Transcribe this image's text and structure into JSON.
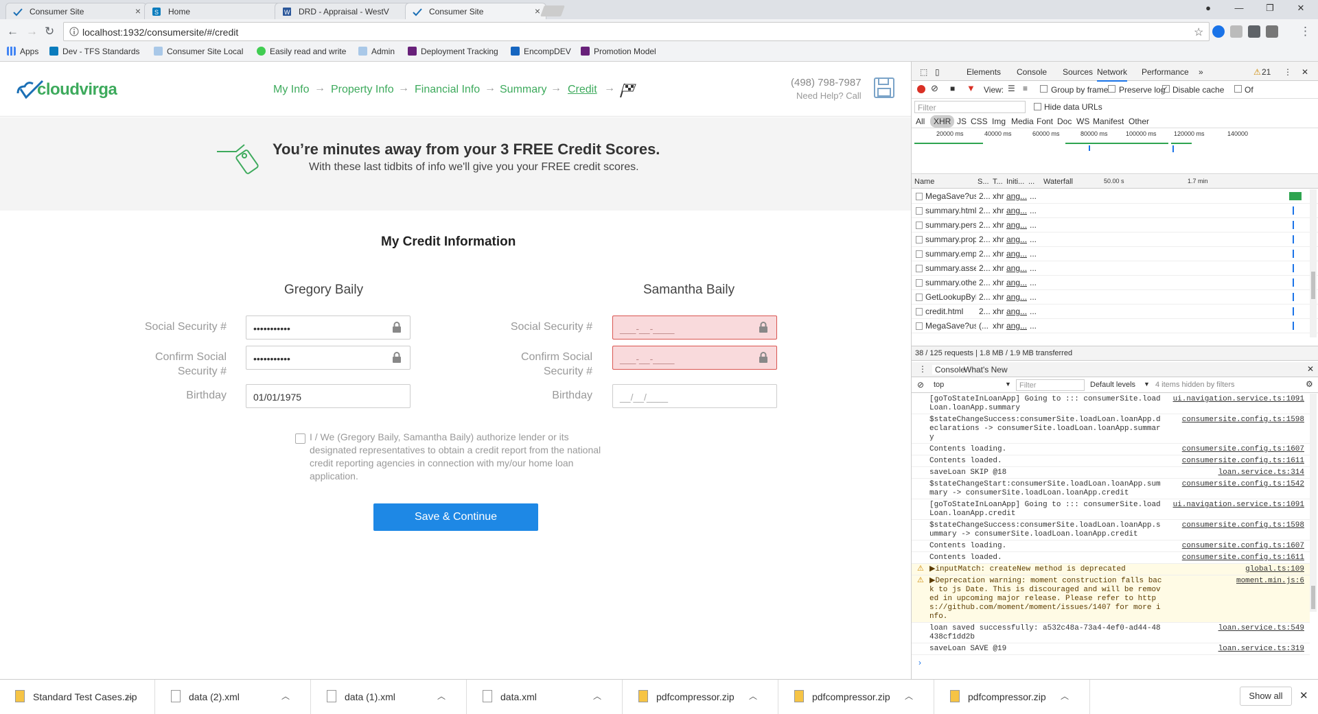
{
  "tabs": [
    {
      "title": "Consumer Site",
      "icon": "cloudvirga-icon"
    },
    {
      "title": "Home",
      "icon": "sharepoint-icon"
    },
    {
      "title": "DRD - Appraisal - WestV",
      "icon": "word-icon"
    },
    {
      "title": "Consumer Site",
      "icon": "cloudvirga-icon",
      "active": true
    }
  ],
  "url": "localhost:1932/consumersite/#/credit",
  "bookmarks": [
    "Apps",
    "Dev - TFS Standards",
    "Consumer Site Local",
    "Easily read and write",
    "Admin",
    "Deployment Tracking",
    "EncompDEV",
    "Promotion Model"
  ],
  "site": {
    "logo": "cloudvirga",
    "steps": [
      "My Info",
      "Property Info",
      "Financial Info",
      "Summary",
      "Credit"
    ],
    "active_step": "Credit",
    "phone": "(498) 798-7987",
    "help": "Need Help? Call",
    "hero_title": "You’re minutes away from your 3 FREE Credit Scores.",
    "hero_sub": "With these last tidbits of info we'll give you your FREE credit scores.",
    "section_title": "My Credit Information",
    "borrowers": [
      {
        "name": "Gregory Baily",
        "ssn_label": "Social Security #",
        "confirm_label_1": "Confirm Social",
        "confirm_label_2": "Security #",
        "birthday_label": "Birthday",
        "ssn": "•••••••••••",
        "confirm": "•••••••••••",
        "birthday": "01/01/1975"
      },
      {
        "name": "Samantha Baily",
        "ssn_label": "Social Security #",
        "confirm_label_1": "Confirm Social",
        "confirm_label_2": "Security #",
        "birthday_label": "Birthday",
        "ssn": "___-__-____",
        "confirm": "___-__-____",
        "birthday": "__/__/____"
      }
    ],
    "authorize_1": "I / We (Gregory Baily, Samantha Baily) authorize lender or its",
    "authorize_2": "designated representatives to obtain a credit report from the national",
    "authorize_3": "credit reporting agencies in connection with my/our home loan",
    "authorize_4": "application.",
    "save_button": "Save & Continue"
  },
  "devtools": {
    "tabs": [
      "Elements",
      "Console",
      "Sources",
      "Network",
      "Performance"
    ],
    "active_tab": "Network",
    "warn_count": "21",
    "view_label": "View:",
    "group_by_frame": "Group by frame",
    "preserve_log": "Preserve log",
    "disable_cache": "Disable cache",
    "offline": "Of",
    "filter_placeholder": "Filter",
    "hide_data_urls": "Hide data URLs",
    "types": [
      "All",
      "XHR",
      "JS",
      "CSS",
      "Img",
      "Media",
      "Font",
      "Doc",
      "WS",
      "Manifest",
      "Other"
    ],
    "timeline_ticks": [
      "20000 ms",
      "40000 ms",
      "60000 ms",
      "80000 ms",
      "100000 ms",
      "120000 ms",
      "140000"
    ],
    "columns": {
      "name": "Name",
      "status": "S...",
      "type": "T...",
      "initiator": "Initi...",
      "more": "...",
      "waterfall": "Waterfall",
      "w1": "50.00 s",
      "w2": "1.7 min"
    },
    "requests": [
      {
        "name": "MegaSave?us...",
        "status": "2...",
        "type": "xhr",
        "init": "ang..."
      },
      {
        "name": "summary.html",
        "status": "2...",
        "type": "xhr",
        "init": "ang..."
      },
      {
        "name": "summary.pers...",
        "status": "2...",
        "type": "xhr",
        "init": "ang..."
      },
      {
        "name": "summary.prop...",
        "status": "2...",
        "type": "xhr",
        "init": "ang..."
      },
      {
        "name": "summary.emp...",
        "status": "2...",
        "type": "xhr",
        "init": "ang..."
      },
      {
        "name": "summary.asse...",
        "status": "2...",
        "type": "xhr",
        "init": "ang..."
      },
      {
        "name": "summary.othe...",
        "status": "2...",
        "type": "xhr",
        "init": "ang..."
      },
      {
        "name": "GetLookupByL...",
        "status": "2...",
        "type": "xhr",
        "init": "ang..."
      },
      {
        "name": "credit.html",
        "status": "2...",
        "type": "xhr",
        "init": "ang..."
      },
      {
        "name": "MegaSave?us...",
        "status": "(...",
        "type": "xhr",
        "init": "ang..."
      }
    ],
    "summary": "38 / 125 requests  |  1.8 MB / 1.9 MB transferred",
    "drawer_tabs": [
      "Console",
      "What's New"
    ],
    "context": "top",
    "console_filter": "Filter",
    "levels": "Default levels",
    "hidden": "4 items hidden by filters",
    "logs": [
      {
        "msg": "[goToStateInLoanApp] Going to ::: consumerSite.loadLoan.loanApp.summary",
        "src": "ui.navigation.service.ts:1091"
      },
      {
        "msg": "$stateChangeSuccess:consumerSite.loadLoan.loanApp.declarations -> consumerSite.loadLoan.loanApp.summary",
        "src": "consumersite.config.ts:1598"
      },
      {
        "msg": "Contents loading.",
        "src": "consumersite.config.ts:1607"
      },
      {
        "msg": "Contents loaded.",
        "src": "consumersite.config.ts:1611"
      },
      {
        "msg": "saveLoan SKIP @18",
        "src": "loan.service.ts:314"
      },
      {
        "msg": "$stateChangeStart:consumerSite.loadLoan.loanApp.summary -> consumerSite.loadLoan.loanApp.credit",
        "src": "consumersite.config.ts:1542"
      },
      {
        "msg": "[goToStateInLoanApp] Going to ::: consumerSite.loadLoan.loanApp.credit",
        "src": "ui.navigation.service.ts:1091"
      },
      {
        "msg": "$stateChangeSuccess:consumerSite.loadLoan.loanApp.summary -> consumerSite.loadLoan.loanApp.credit",
        "src": "consumersite.config.ts:1598"
      },
      {
        "msg": "Contents loading.",
        "src": "consumersite.config.ts:1607"
      },
      {
        "msg": "Contents loaded.",
        "src": "consumersite.config.ts:1611"
      },
      {
        "msg": "▶inputMatch: createNew method is deprecated",
        "src": "global.ts:109",
        "warn": true
      },
      {
        "msg": "▶Deprecation warning: moment construction falls back to js Date. This is discouraged and will be removed in upcoming major release. Please refer to https://github.com/moment/moment/issues/1407 for more info.",
        "src": "moment.min.js:6",
        "warn": true
      },
      {
        "msg": "loan saved successfully: a532c48a-73a4-4ef0-ad44-48438cf1dd2b",
        "src": "loan.service.ts:549"
      },
      {
        "msg": "saveLoan SAVE @19",
        "src": "loan.service.ts:319"
      }
    ]
  },
  "downloads": [
    "Standard Test Cases.zip",
    "data (2).xml",
    "data (1).xml",
    "data.xml",
    "pdfcompressor.zip",
    "pdfcompressor.zip",
    "pdfcompressor.zip"
  ],
  "show_all": "Show all",
  "colors": {
    "brand_green": "#3daa5c",
    "brand_blue": "#1a6fb5",
    "button_blue": "#1e88e5",
    "error_bg": "#f9dadc",
    "error_border": "#d9534f"
  }
}
